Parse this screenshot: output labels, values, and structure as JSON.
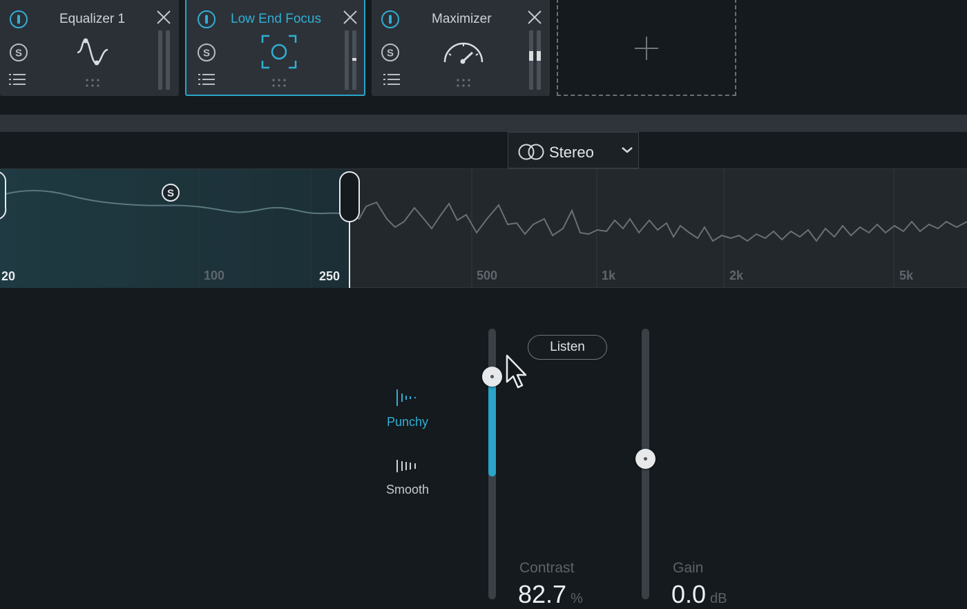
{
  "module_chain": {
    "modules": [
      {
        "title": "Equalizer 1",
        "icon": "eq-curve-icon",
        "selected": false
      },
      {
        "title": "Low End Focus",
        "icon": "focus-target-icon",
        "selected": true
      },
      {
        "title": "Maximizer",
        "icon": "gauge-icon",
        "selected": false
      }
    ],
    "add_icon": "plus-icon"
  },
  "stereo_mode": {
    "label": "Stereo",
    "icon": "stereo-rings-icon"
  },
  "spectrum": {
    "band_badge": "S",
    "freq_labels": [
      "20",
      "100",
      "250",
      "500",
      "1k",
      "2k",
      "5k"
    ],
    "active_labels": [
      "20",
      "250"
    ]
  },
  "mode": {
    "options": [
      {
        "label": "Punchy",
        "active": true
      },
      {
        "label": "Smooth",
        "active": false
      }
    ]
  },
  "listen_label": "Listen",
  "contrast": {
    "label": "Contrast",
    "value": "82.7",
    "unit": "%",
    "slider_fraction": 0.85
  },
  "gain": {
    "label": "Gain",
    "value": "0.0",
    "unit": "dB",
    "slider_fraction": 0.5
  },
  "colors": {
    "accent": "#2aa4c9",
    "background": "#141a1e",
    "panel": "#2b3036"
  }
}
